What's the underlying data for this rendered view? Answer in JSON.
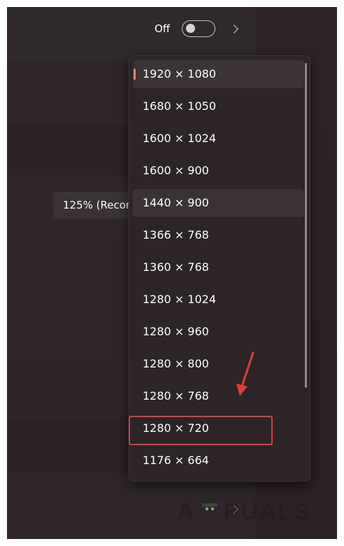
{
  "toggle": {
    "label": "Off",
    "state": false
  },
  "scale": {
    "value": "125% (Recor"
  },
  "resolution_dropdown": {
    "options": [
      "1920 × 1080",
      "1680 × 1050",
      "1600 × 1024",
      "1600 × 900",
      "1440 × 900",
      "1366 × 768",
      "1360 × 768",
      "1280 × 1024",
      "1280 × 960",
      "1280 × 800",
      "1280 × 768",
      "1280 × 720",
      "1176 × 664"
    ],
    "selected": "1920 × 1080",
    "hovered": "1440 × 900",
    "highlighted": "1280 × 720"
  },
  "watermark": {
    "text": "APPUALS"
  },
  "colors": {
    "accent": "#e7846a",
    "annotation": "#e23b3b"
  },
  "icons": {
    "chevron": "chevron-right-icon",
    "arrow": "red-arrow-icon"
  }
}
